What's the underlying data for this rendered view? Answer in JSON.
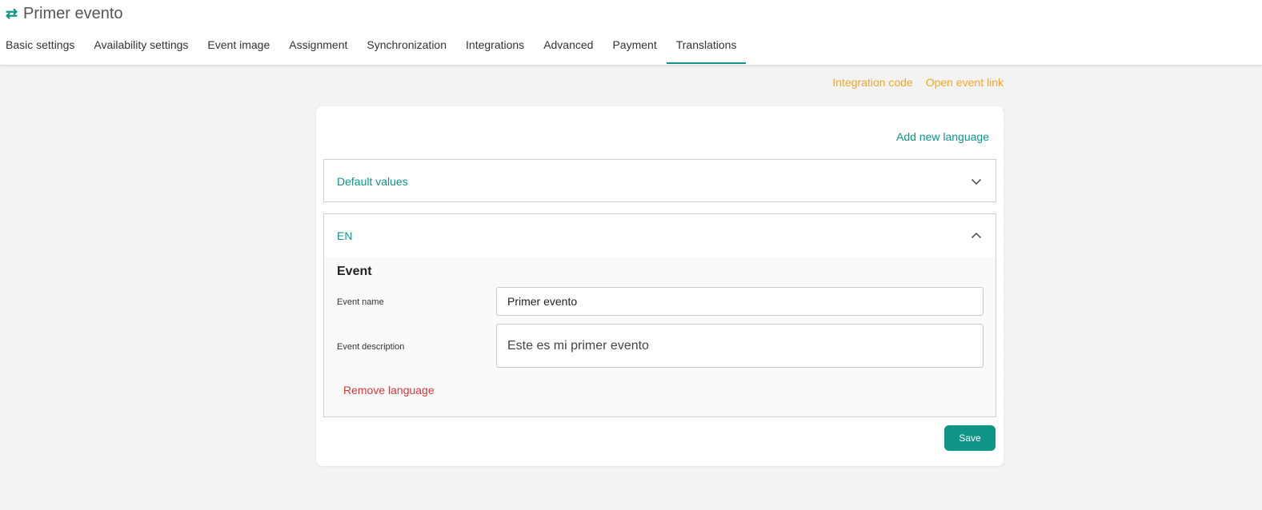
{
  "header": {
    "title": "Primer evento",
    "title_icon": "swap-icon"
  },
  "tabs": [
    {
      "label": "Basic settings",
      "active": false
    },
    {
      "label": "Availability settings",
      "active": false
    },
    {
      "label": "Event image",
      "active": false
    },
    {
      "label": "Assignment",
      "active": false
    },
    {
      "label": "Synchronization",
      "active": false
    },
    {
      "label": "Integrations",
      "active": false
    },
    {
      "label": "Advanced",
      "active": false
    },
    {
      "label": "Payment",
      "active": false
    },
    {
      "label": "Translations",
      "active": true
    }
  ],
  "top_links": {
    "integration_code": "Integration code",
    "open_event_link": "Open event link"
  },
  "card": {
    "add_language": "Add new language",
    "default_panel": {
      "label": "Default values",
      "expanded": false,
      "icon": "chevron-down-icon"
    },
    "language_panel": {
      "label": "EN",
      "expanded": true,
      "icon": "chevron-up-icon",
      "section_title": "Event",
      "event_name_label": "Event name",
      "event_name_value": "Primer evento",
      "event_description_label": "Event description",
      "event_description_value": "Este es mi primer evento",
      "remove_language": "Remove language"
    },
    "save_label": "Save"
  },
  "colors": {
    "accent": "#0f9488",
    "link_orange": "#f5a623",
    "danger": "#d9363e"
  }
}
